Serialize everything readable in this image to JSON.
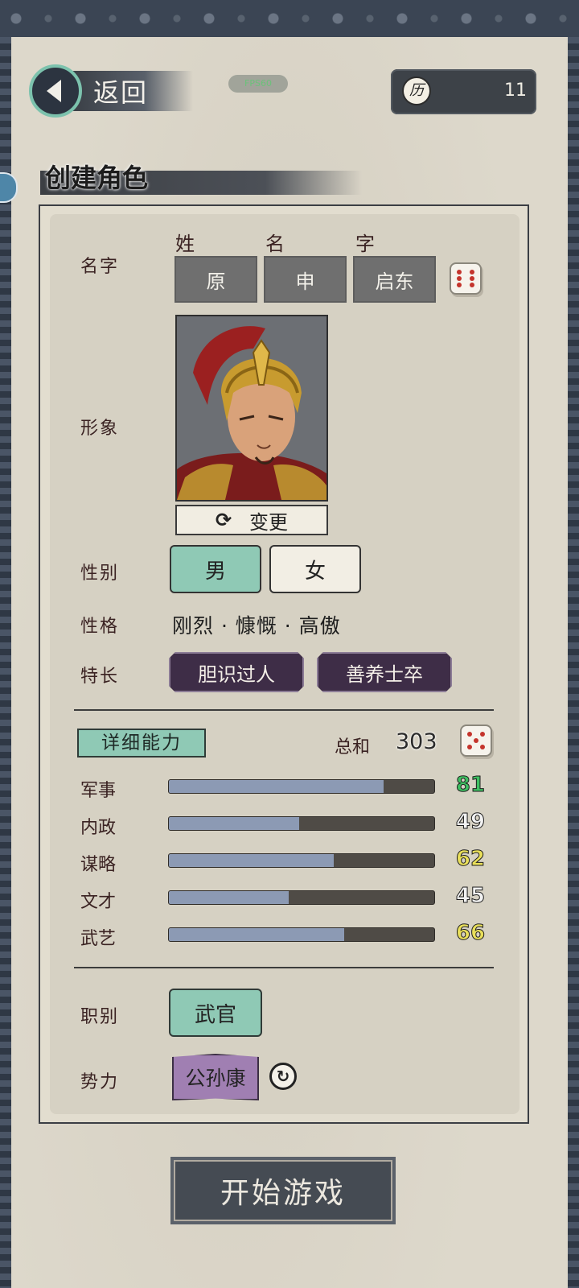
{
  "header": {
    "back_label": "返回",
    "fps_label": "FPS60",
    "score_icon_char": "历",
    "score_value": "11",
    "page_title": "创建角色"
  },
  "name": {
    "label": "名字",
    "surname_head": "姓",
    "given_head": "名",
    "courtesy_head": "字",
    "surname": "原",
    "given": "申",
    "courtesy": "启东"
  },
  "portrait": {
    "label": "形象",
    "change_label": "变更"
  },
  "gender": {
    "label": "性别",
    "male": "男",
    "female": "女",
    "selected": "男"
  },
  "personality": {
    "label": "性格",
    "traits": "刚烈 · 慷慨 · 高傲"
  },
  "specialty": {
    "label": "特长",
    "tags": [
      "胆识过人",
      "善养士卒"
    ]
  },
  "abilities": {
    "detail_label": "详细能力",
    "sum_label": "总和",
    "sum_value": "303",
    "max": 100,
    "stats": [
      {
        "label": "军事",
        "value": 81,
        "display": "81",
        "color": "#3fbf62"
      },
      {
        "label": "内政",
        "value": 49,
        "display": "49",
        "color": "#f2f2f2"
      },
      {
        "label": "谋略",
        "value": 62,
        "display": "62",
        "color": "#e9df5a"
      },
      {
        "label": "文才",
        "value": 45,
        "display": "45",
        "color": "#f2f2f2"
      },
      {
        "label": "武艺",
        "value": 66,
        "display": "66",
        "color": "#e9df5a"
      }
    ]
  },
  "role": {
    "label": "职别",
    "value": "武官"
  },
  "faction": {
    "label": "势力",
    "value": "公孙康"
  },
  "start_button": "开始游戏",
  "colors": {
    "accent_teal": "#8fc9b5",
    "specialty_purple": "#3e2d47",
    "faction_purple": "#a07fb2",
    "bar_fill": "#8c9ab4"
  }
}
